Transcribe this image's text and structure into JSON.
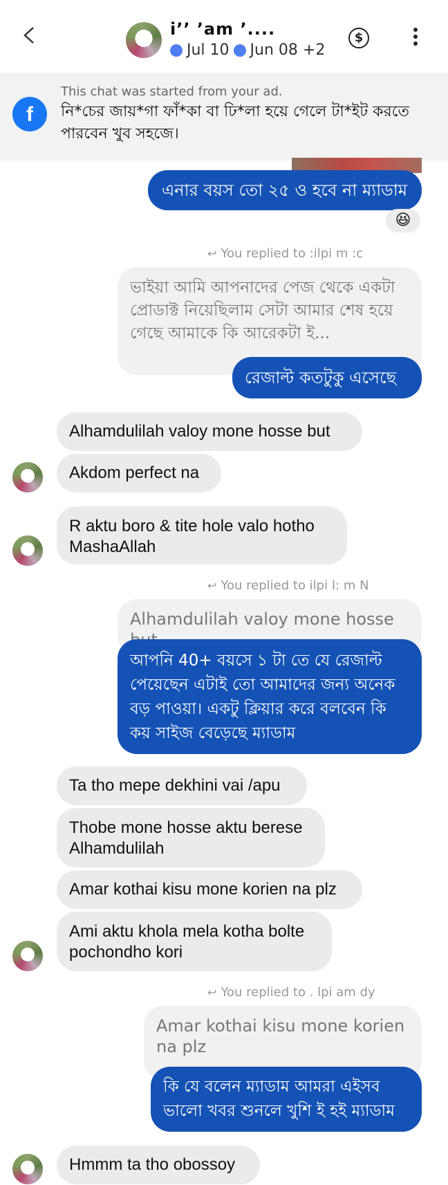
{
  "header": {
    "contact_name": "i’’ ’am ’....",
    "labels": [
      "Jul 10",
      "Jun 08 +2"
    ]
  },
  "banner": {
    "title": "This chat was started from your ad.",
    "text": "নি*চের জায়*গা ফাঁ*কা বা ঢি*লা হয়ে গেলে টা*ইট করতে পারবেন খুব সহজে।"
  },
  "messages": {
    "m1": "এনার বয়স তো ২৫ ও হবে না ম্যাডাম",
    "reaction": "😆",
    "reply1_label": "You replied to :ilpi    m :c",
    "quote1": "ভাইয়া আমি আপনাদের পেজ থেকে একটা প্রোডাক্ট নিয়েছিলাম সেটা আমার শেষ হয়ে গেছে আমাকে কি আরেকটা ই...",
    "m2": "রেজাল্ট কতটুকু এসেছে",
    "m3": "Alhamdulilah  valoy mone hosse but",
    "m4": "Akdom perfect na",
    "m5": "R aktu   boro & tite hole valo hotho MashaAllah",
    "reply2_label": "You replied to  ilpi I:   m N",
    "quote2": "Alhamdulilah  valoy mone hosse but",
    "m6": "আপনি 40+ বয়সে ১ টা তে যে রেজাল্ট পেয়েছেন এটাই তো আমাদের জন্য অনেক বড় পাওয়া। একটু ক্লিয়ার করে বলবেন কি কয় সাইজ বেড়েছে ম্যাডাম",
    "m7": "Ta tho mepe dekhini vai /apu",
    "m8": "Thobe mone hosse aktu berese Alhamdulilah",
    "m9": "Amar kothai kisu mone korien na plz",
    "m10": "Ami aktu khola mela kotha bolte pochondho kori",
    "reply3_label": "You replied to . lpi  am    dy",
    "quote3": "Amar kothai kisu mone korien na plz",
    "m11": "কি যে বলেন ম্যাডাম আমরা এইসব ভালো খবর শুনলে খুশি ই হই ম্যাডাম",
    "m12": "Hmmm ta tho obossoy"
  },
  "icons": [
    "back-arrow-icon",
    "dollar-icon",
    "more-menu-icon",
    "facebook-icon",
    "reply-arrow-icon"
  ],
  "colors": {
    "outgoing": "#1552b5",
    "incoming": "#ebebeb",
    "label_dot": "#4f7ef0",
    "facebook": "#1877f2"
  }
}
